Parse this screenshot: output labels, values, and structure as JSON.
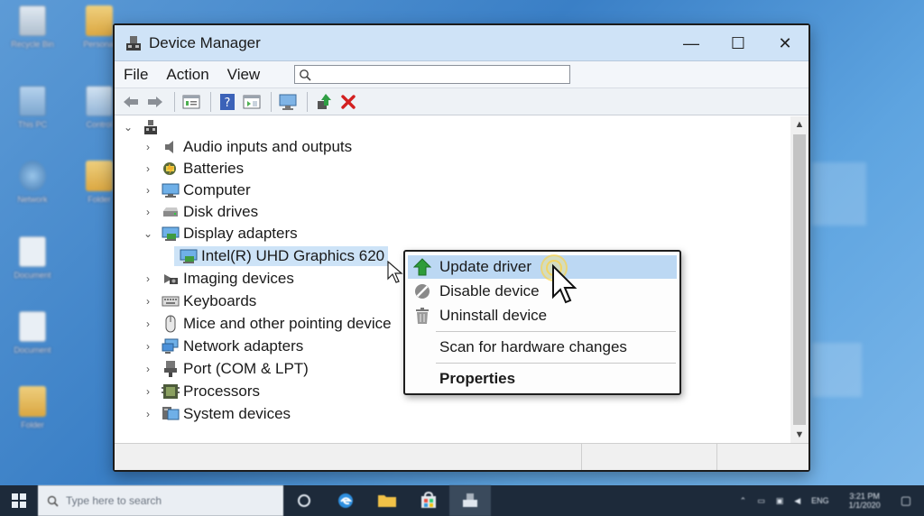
{
  "desktop": {
    "icons_left": [
      {
        "label": "Recycle Bin",
        "icon": "recycle-bin-icon"
      },
      {
        "label": "This PC",
        "icon": "computer-icon"
      },
      {
        "label": "Network",
        "icon": "network-icon"
      },
      {
        "label": "Document",
        "icon": "document-icon"
      },
      {
        "label": "Document",
        "icon": "document-icon"
      },
      {
        "label": "Folder",
        "icon": "folder-icon"
      }
    ],
    "icons_right": [
      {
        "label": "Personal",
        "icon": "user-folder-icon"
      },
      {
        "label": "Control",
        "icon": "control-panel-icon"
      },
      {
        "label": "Folder",
        "icon": "folder-icon"
      }
    ]
  },
  "window": {
    "title": "Device Manager",
    "minimize": "—",
    "maximize": "☐",
    "close": "✕"
  },
  "menu": {
    "items": [
      "File",
      "Action",
      "View"
    ],
    "search_placeholder": ""
  },
  "toolbar": {
    "buttons": [
      "back-icon",
      "forward-icon",
      "properties-icon",
      "help-icon",
      "show-hide-icon",
      "monitor-icon",
      "update-driver-icon",
      "uninstall-icon"
    ]
  },
  "tree": {
    "root_icon": "computer-root-icon",
    "nodes": [
      {
        "label": "Audio inputs and outputs",
        "icon": "speaker-icon",
        "expanded": false
      },
      {
        "label": "Batteries",
        "icon": "battery-icon",
        "expanded": false
      },
      {
        "label": "Computer",
        "icon": "monitor-icon",
        "expanded": false
      },
      {
        "label": "Disk drives",
        "icon": "disk-drive-icon",
        "expanded": false
      },
      {
        "label": "Display adapters",
        "icon": "display-adapter-icon",
        "expanded": true
      },
      {
        "label": "Intel(R) UHD Graphics 620",
        "icon": "display-adapter-icon",
        "child": true,
        "selected": true
      },
      {
        "label": "Imaging devices",
        "icon": "camera-icon",
        "expanded": false
      },
      {
        "label": "Keyboards",
        "icon": "keyboard-icon",
        "expanded": false
      },
      {
        "label": "Mice and other pointing device",
        "icon": "mouse-icon",
        "expanded": false
      },
      {
        "label": "Network adapters",
        "icon": "network-adapter-icon",
        "expanded": false
      },
      {
        "label": "Port (COM & LPT)",
        "icon": "port-icon",
        "expanded": false
      },
      {
        "label": "Processors",
        "icon": "processor-icon",
        "expanded": false
      },
      {
        "label": "System devices",
        "icon": "system-device-icon",
        "expanded": false
      }
    ]
  },
  "context_menu": {
    "items": [
      {
        "label": "Update driver",
        "icon": "green-up-arrow-icon",
        "highlighted": true
      },
      {
        "label": "Disable device",
        "icon": "disable-icon"
      },
      {
        "label": "Uninstall device",
        "icon": "trash-icon"
      },
      {
        "label": "Scan for hardware changes",
        "icon": ""
      },
      {
        "label": "Properties",
        "icon": "",
        "bold": true
      }
    ]
  },
  "taskbar": {
    "search_placeholder": "Type here to search",
    "tray_lang": "ENG",
    "time": "3:21 PM",
    "date": "1/1/2020"
  },
  "colors": {
    "titlebar": "#cfe3f7",
    "highlight": "#bcd8f3",
    "selection": "#cde3f7",
    "desktop": "#3a7fc6",
    "taskbar": "#1d2a3a"
  }
}
